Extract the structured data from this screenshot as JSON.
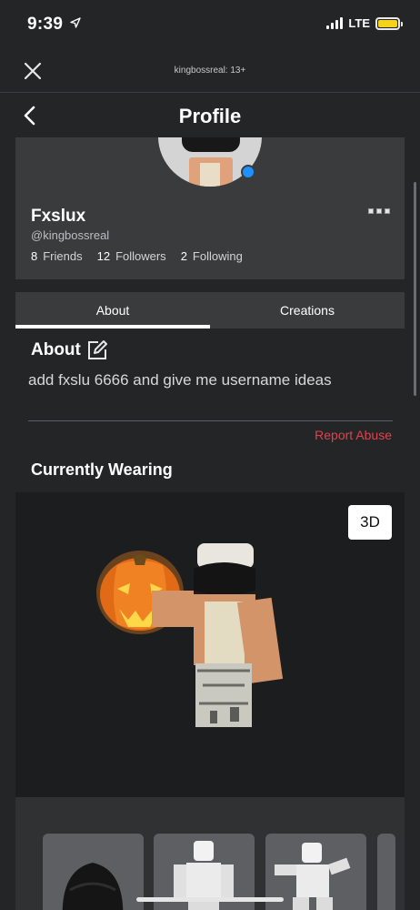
{
  "status_bar": {
    "time": "9:39",
    "network": "LTE"
  },
  "browser": {
    "url_label": "kingbossreal: 13+"
  },
  "nav": {
    "title": "Profile"
  },
  "profile": {
    "display_name": "Fxslux",
    "username": "@kingbossreal",
    "stats": [
      {
        "value": "8",
        "label": "Friends"
      },
      {
        "value": "12",
        "label": "Followers"
      },
      {
        "value": "2",
        "label": "Following"
      }
    ]
  },
  "tabs": [
    {
      "label": "About",
      "active": true
    },
    {
      "label": "Creations",
      "active": false
    }
  ],
  "about": {
    "heading": "About",
    "text": "add fxslu 6666 and give me username ideas",
    "report_label": "Report Abuse"
  },
  "wearing": {
    "heading": "Currently Wearing",
    "view_toggle": "3D"
  },
  "colors": {
    "background": "#232527",
    "card": "#393b3d",
    "report": "#e2414c",
    "online": "#1e90ff",
    "battery": "#f7d21b"
  },
  "icons": [
    "location-arrow-icon",
    "signal-icon",
    "battery-icon",
    "close-icon",
    "back-chevron-icon",
    "more-icon",
    "edit-icon"
  ]
}
